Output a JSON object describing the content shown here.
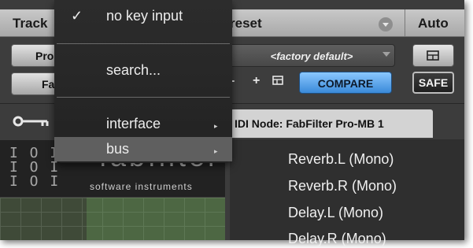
{
  "header": {
    "track": "Track",
    "preset": "reset",
    "auto": "Auto"
  },
  "controls": {
    "left_button_1": "Pro",
    "left_button_2": "Fa",
    "preset_name": "<factory default>",
    "dash": "-",
    "plus": "+",
    "compare": "COMPARE",
    "safe": "SAFE"
  },
  "key_row": {
    "node_tab": "IDI Node: FabFilter Pro-MB 1"
  },
  "plugin_art": {
    "logo": "fabfilter",
    "subtitle": "software instruments"
  },
  "menu": {
    "no_key_input": "no key input",
    "search": "search...",
    "interface": "interface",
    "bus": "bus"
  },
  "submenu": {
    "items": [
      "Reverb.L (Mono)",
      "Reverb.R (Mono)",
      "Delay.L (Mono)",
      "Delay.R (Mono)"
    ]
  },
  "icons": {
    "checkmark": "checkmark-icon",
    "submenu_arrow": "chevron-right-icon",
    "key": "key-icon",
    "copy": "copy-icon",
    "preset_menu": "chevron-down-icon"
  },
  "colors": {
    "compare_accent": "#4a9ae6",
    "menu_background": "#262626",
    "highlight": "#5f5f5f"
  }
}
